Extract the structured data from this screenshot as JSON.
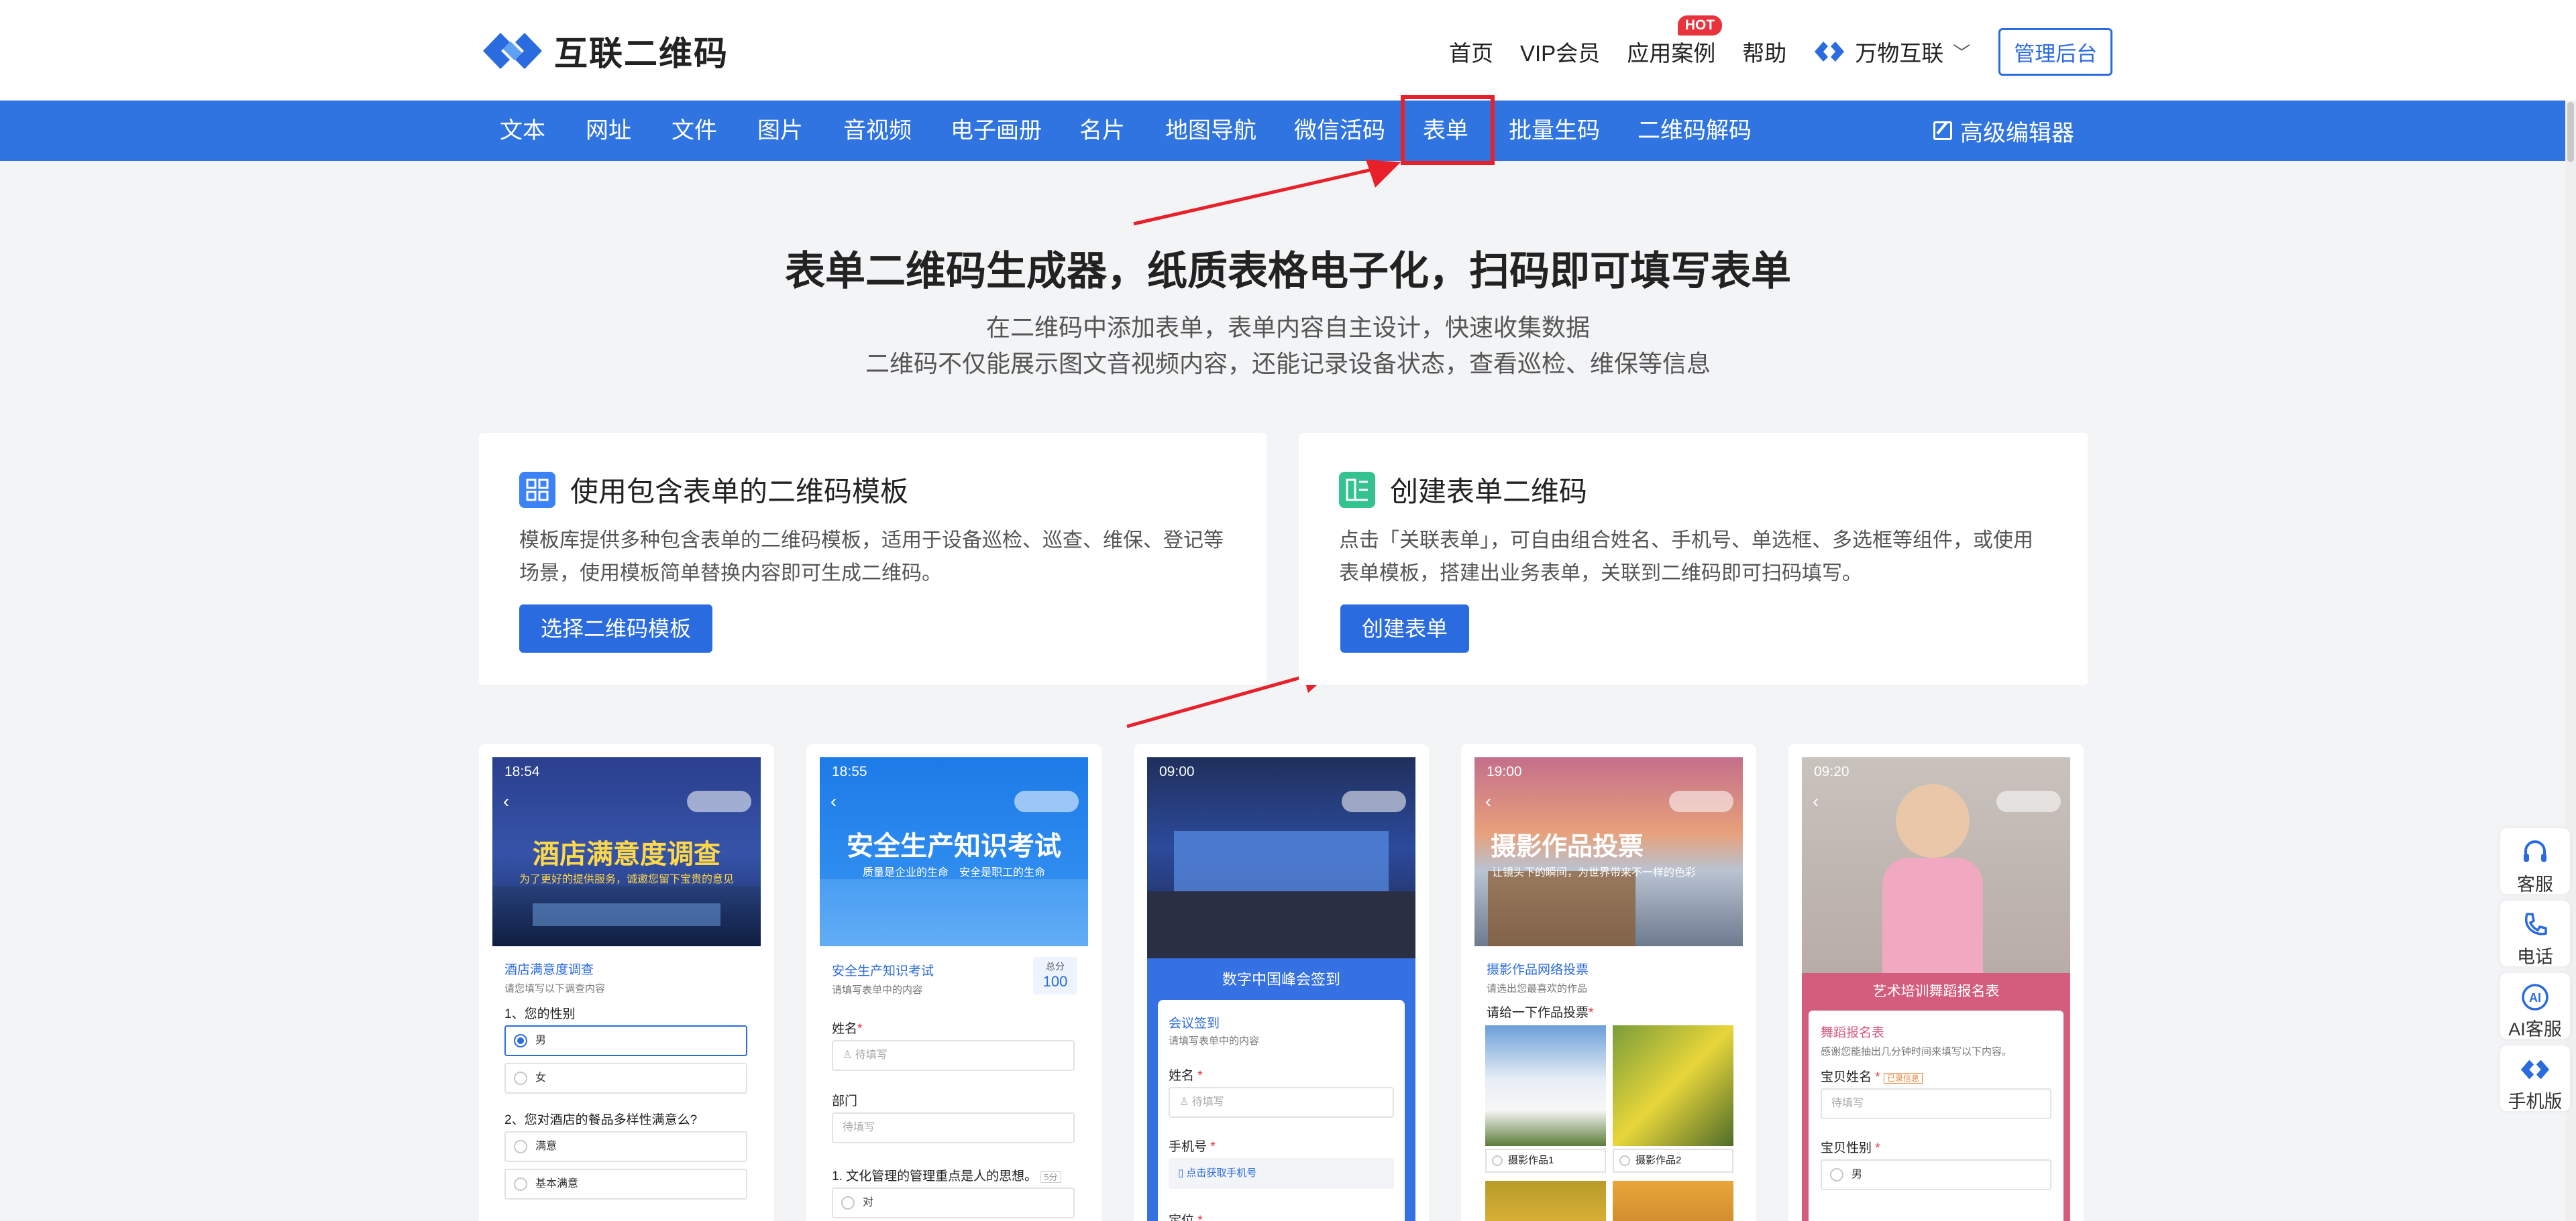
{
  "header": {
    "logo_text": "互联二维码",
    "nav": [
      "首页",
      "VIP会员",
      "应用案例",
      "帮助"
    ],
    "hot_badge": "HOT",
    "brand": "万物互联",
    "admin_button": "管理后台"
  },
  "navbar": {
    "items": [
      "文本",
      "网址",
      "文件",
      "图片",
      "音视频",
      "电子画册",
      "名片",
      "地图导航",
      "微信活码",
      "表单",
      "批量生码",
      "二维码解码"
    ],
    "advanced_editor": "高级编辑器",
    "active": "表单"
  },
  "hero": {
    "title": "表单二维码生成器，纸质表格电子化，扫码即可填写表单",
    "subtitle_1": "在二维码中添加表单，表单内容自主设计，快速收集数据",
    "subtitle_2": "二维码不仅能展示图文音视频内容，还能记录设备状态，查看巡检、维保等信息"
  },
  "cards": {
    "template": {
      "title": "使用包含表单的二维码模板",
      "description": "模板库提供多种包含表单的二维码模板，适用于设备巡检、巡查、维保、登记等场景，使用模板简单替换内容即可生成二维码。",
      "button": "选择二维码模板"
    },
    "create": {
      "title": "创建表单二维码",
      "description": "点击「关联表单」，可自由组合姓名、手机号、单选框、多选框等组件，或使用表单模板，搭建出业务表单，关联到二维码即可扫码填写。",
      "button": "创建表单"
    }
  },
  "phones": {
    "hotel": {
      "time": "18:54",
      "banner_title": "酒店满意度调查",
      "banner_sub": "为了更好的提供服务，诚邀您留下宝贵的意见",
      "form_title": "酒店满意度调查",
      "hint": "请您填写以下调查内容",
      "q1": "1、您的性别",
      "q1_opts": [
        "男",
        "女"
      ],
      "q2": "2、您对酒店的餐品多样性满意么?",
      "q2_opts": [
        "满意",
        "基本满意"
      ]
    },
    "safety": {
      "time": "18:55",
      "banner_title": "安全生产知识考试",
      "banner_sub": "质量是企业的生命　安全是职工的生命",
      "form_title": "安全生产知识考试",
      "hint": "请填写表单中的内容",
      "score_label": "总分",
      "score": "100",
      "name_label": "姓名",
      "name_placeholder": "待填写",
      "dept_label": "部门",
      "dept_placeholder": "待填写",
      "q1": "1. 文化管理的管理重点是人的思想。",
      "q1_tag": "5分",
      "q1_opt": "对"
    },
    "summit": {
      "time": "09:00",
      "header": "数字中国峰会签到",
      "form_title": "会议签到",
      "hint": "请填写表单中的内容",
      "name_label": "姓名",
      "name_placeholder": "待填写",
      "phone_label": "手机号",
      "phone_button": "点击获取手机号",
      "position_label": "定位"
    },
    "photo": {
      "time": "19:00",
      "banner_title": "摄影作品投票",
      "banner_sub": "让镜头下的瞬间，为世界带来不一样的色彩",
      "form_title": "摄影作品网络投票",
      "hint": "请选出您最喜欢的作品",
      "q": "请给一下作品投票",
      "opt1": "摄影作品1",
      "opt2": "摄影作品2"
    },
    "dance": {
      "time": "09:20",
      "header": "艺术培训舞蹈报名表",
      "form_title": "舞蹈报名表",
      "hint": "感谢您能抽出几分钟时间来填写以下内容。",
      "name_label": "宝贝姓名",
      "name_tag": "已录信息",
      "name_placeholder": "待填写",
      "gender_label": "宝贝性别",
      "gender_opt": "男"
    }
  },
  "side_tools": [
    "客服",
    "电话",
    "AI客服",
    "手机版"
  ],
  "colors": {
    "primary": "#2b6be0",
    "navbar": "#2f74e0",
    "highlight": "#e8202a"
  }
}
